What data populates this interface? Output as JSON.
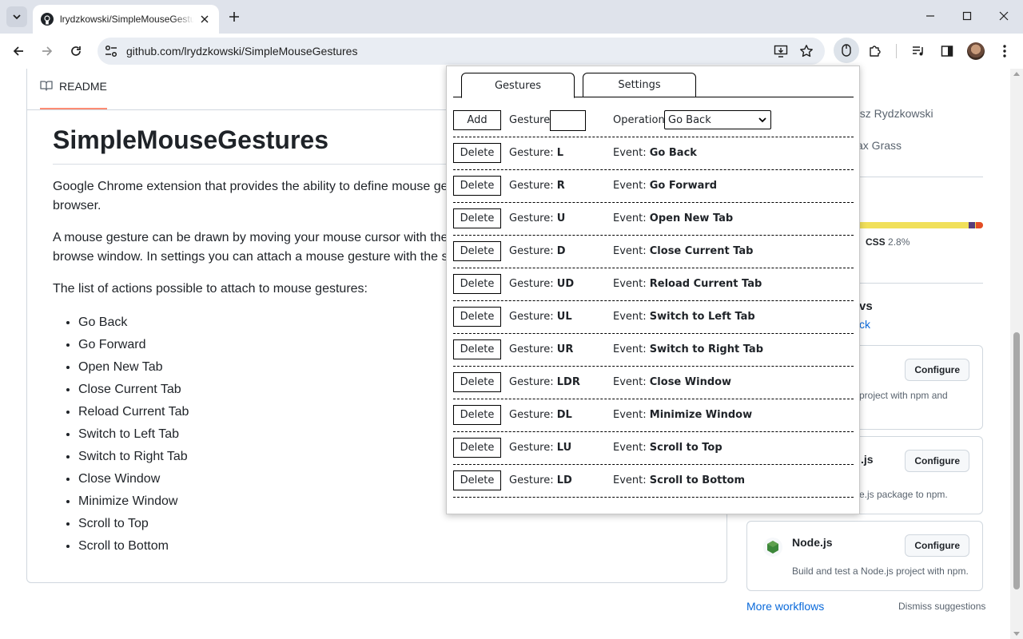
{
  "browser": {
    "tab_title": "lrydzkowski/SimpleMouseGestures",
    "url": "github.com/lrydzkowski/SimpleMouseGestures"
  },
  "readme": {
    "tab_label": "README",
    "heading": "SimpleMouseGestures",
    "p1": "Google Chrome extension that provides the ability to define mouse ge",
    "p1b": "browser.",
    "p2": "A mouse gesture can be drawn by moving your mouse cursor with the",
    "p2b": "browse window. In settings you can attach a mouse gesture with the s",
    "p3": "The list of actions possible to attach to mouse gestures:",
    "actions": [
      "Go Back",
      "Go Forward",
      "Open New Tab",
      "Close Current Tab",
      "Reload Current Tab",
      "Switch to Left Tab",
      "Switch to Right Tab",
      "Close Window",
      "Minimize Window",
      "Scroll to Top",
      "Scroll to Bottom"
    ]
  },
  "sidebar": {
    "contributor1": "asz Rydzkowski",
    "contributor2": "ax Grass",
    "css_label": "CSS",
    "css_pct": "2.8%",
    "workflows_heading": "vs",
    "workflows_sub": "ck",
    "card1_desc": "project with npm and",
    "card2_title": ".js",
    "card2_desc": "e.js package to npm.",
    "card3_title": "Node.js",
    "card3_desc": "Build and test a Node.js project with npm.",
    "configure": "Configure",
    "more_workflows": "More workflows",
    "dismiss": "Dismiss suggestions",
    "language_bar": {
      "css_share": 2.8,
      "colors": [
        "#f1e05a",
        "#563d7c",
        "#e34c26"
      ]
    }
  },
  "popup": {
    "tabs": [
      "Gestures",
      "Settings"
    ],
    "add_label": "Add",
    "gesture_label": "Gesture:",
    "operation_label": "Operation:",
    "operation_selected": "Go Back",
    "event_label": "Event:",
    "delete_label": "Delete",
    "rows": [
      {
        "gesture": "L",
        "event": "Go Back"
      },
      {
        "gesture": "R",
        "event": "Go Forward"
      },
      {
        "gesture": "U",
        "event": "Open New Tab"
      },
      {
        "gesture": "D",
        "event": "Close Current Tab"
      },
      {
        "gesture": "UD",
        "event": "Reload Current Tab"
      },
      {
        "gesture": "UL",
        "event": "Switch to Left Tab"
      },
      {
        "gesture": "UR",
        "event": "Switch to Right Tab"
      },
      {
        "gesture": "LDR",
        "event": "Close Window"
      },
      {
        "gesture": "DL",
        "event": "Minimize Window"
      },
      {
        "gesture": "LU",
        "event": "Scroll to Top"
      },
      {
        "gesture": "LD",
        "event": "Scroll to Bottom"
      }
    ]
  }
}
